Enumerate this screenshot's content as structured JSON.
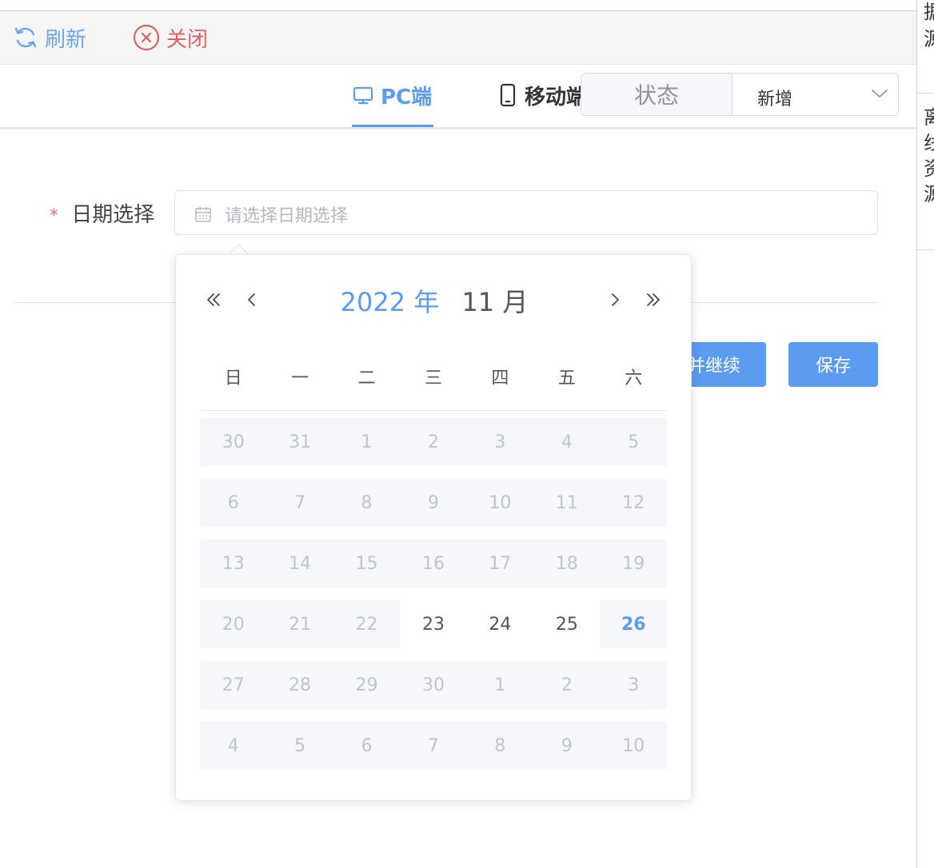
{
  "toolbar": {
    "refresh_label": "刷新",
    "close_label": "关闭"
  },
  "tabs": {
    "pc_label": "PC端",
    "mobile_label": "移动端"
  },
  "status": {
    "label": "状态",
    "value": "新增"
  },
  "form": {
    "date_label": "日期选择",
    "required_mark": "*",
    "date_placeholder": "请选择日期选择"
  },
  "buttons": {
    "continue_label": "并继续",
    "save_label": "保存"
  },
  "right_pane": {
    "chars": [
      "据",
      "源",
      "离",
      "线",
      "资",
      "源"
    ]
  },
  "picker": {
    "year_label": "2022 年",
    "month_label": "11 月",
    "weekdays": [
      "日",
      "一",
      "二",
      "三",
      "四",
      "五",
      "六"
    ],
    "weeks": [
      [
        {
          "d": "30",
          "s": "disabled"
        },
        {
          "d": "31",
          "s": "disabled"
        },
        {
          "d": "1",
          "s": "disabled"
        },
        {
          "d": "2",
          "s": "disabled"
        },
        {
          "d": "3",
          "s": "disabled"
        },
        {
          "d": "4",
          "s": "disabled"
        },
        {
          "d": "5",
          "s": "disabled"
        }
      ],
      [
        {
          "d": "6",
          "s": "disabled"
        },
        {
          "d": "7",
          "s": "disabled"
        },
        {
          "d": "8",
          "s": "disabled"
        },
        {
          "d": "9",
          "s": "disabled"
        },
        {
          "d": "10",
          "s": "disabled"
        },
        {
          "d": "11",
          "s": "disabled"
        },
        {
          "d": "12",
          "s": "disabled"
        }
      ],
      [
        {
          "d": "13",
          "s": "disabled"
        },
        {
          "d": "14",
          "s": "disabled"
        },
        {
          "d": "15",
          "s": "disabled"
        },
        {
          "d": "16",
          "s": "disabled"
        },
        {
          "d": "17",
          "s": "disabled"
        },
        {
          "d": "18",
          "s": "disabled"
        },
        {
          "d": "19",
          "s": "disabled"
        }
      ],
      [
        {
          "d": "20",
          "s": "disabled"
        },
        {
          "d": "21",
          "s": "disabled"
        },
        {
          "d": "22",
          "s": "disabled"
        },
        {
          "d": "23",
          "s": "available"
        },
        {
          "d": "24",
          "s": "available"
        },
        {
          "d": "25",
          "s": "available"
        },
        {
          "d": "26",
          "s": "today"
        }
      ],
      [
        {
          "d": "27",
          "s": "disabled"
        },
        {
          "d": "28",
          "s": "disabled"
        },
        {
          "d": "29",
          "s": "disabled"
        },
        {
          "d": "30",
          "s": "disabled"
        },
        {
          "d": "1",
          "s": "disabled"
        },
        {
          "d": "2",
          "s": "disabled"
        },
        {
          "d": "3",
          "s": "disabled"
        }
      ],
      [
        {
          "d": "4",
          "s": "disabled"
        },
        {
          "d": "5",
          "s": "disabled"
        },
        {
          "d": "6",
          "s": "disabled"
        },
        {
          "d": "7",
          "s": "disabled"
        },
        {
          "d": "8",
          "s": "disabled"
        },
        {
          "d": "9",
          "s": "disabled"
        },
        {
          "d": "10",
          "s": "disabled"
        }
      ]
    ]
  },
  "colors": {
    "primary": "#5b9bf0",
    "danger": "#e06060",
    "disabled_text": "#c0c4cc",
    "disabled_bg": "#f5f7fa"
  },
  "icons": [
    "refresh-icon",
    "close-circle-icon",
    "monitor-icon",
    "mobile-icon",
    "chevron-down-icon",
    "calendar-icon",
    "double-left-icon",
    "left-icon",
    "right-icon",
    "double-right-icon"
  ]
}
